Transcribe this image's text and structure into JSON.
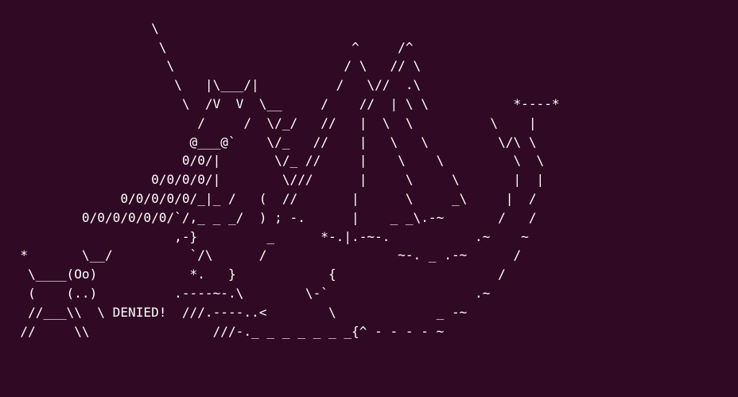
{
  "terminal": {
    "background_color": "#300a24",
    "foreground_color": "#ffffff",
    "lines": [
      "",
      "                   \\",
      "                    \\                        ^     /^",
      "                     \\                      / \\   // \\",
      "                      \\   |\\___/|          /   \\//  .\\",
      "                       \\  /V  V  \\__     /    //  | \\ \\           *----*",
      "                         /     /  \\/_/   //   |  \\  \\          \\    |",
      "                        @___@`    \\/_   //    |   \\   \\         \\/\\ \\",
      "                       0/0/|       \\/_ //     |    \\    \\         \\  \\",
      "                   0/0/0/0/|        \\///      |     \\     \\       |  |",
      "               0/0/0/0/0/_|_ /   (  //       |      \\     _\\     |  /",
      "          0/0/0/0/0/0/`/,_ _ _/  ) ; -.      |    _ _\\.-~       /   /",
      "                      ,-}         _      *-.|.-~-.           .~    ~",
      "  *       \\__/          `/\\      /                 ~-. _ .-~      /",
      "   \\____(Oo)            *.   }            {                     /",
      "   (    (..)          .----~-.\\        \\-`                   .~",
      "   //___\\\\  \\ DENIED!  ///.----..<        \\             _ -~",
      "  //     \\\\                ///-._ _ _ _ _ _ _{^ - - - - ~"
    ]
  }
}
